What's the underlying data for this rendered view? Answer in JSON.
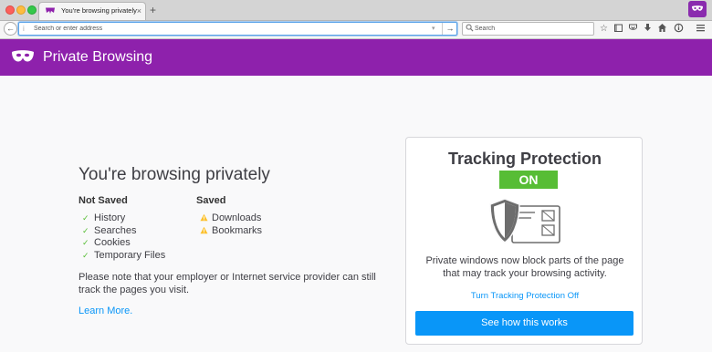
{
  "tab": {
    "title": "You're browsing privately",
    "close": "×",
    "new_tab": "+"
  },
  "navbar": {
    "back": "←",
    "url_placeholder": "Search or enter address",
    "url_info": "i",
    "url_dropdown": "▾",
    "url_go": "→",
    "search_placeholder": "Search",
    "toolbar_icons": [
      "star-icon",
      "reading-list-icon",
      "pocket-icon",
      "download-icon",
      "home-icon",
      "sync-icon",
      "menu-icon"
    ]
  },
  "header": {
    "title": "Private Browsing"
  },
  "main": {
    "title": "You're browsing privately",
    "not_saved": {
      "heading": "Not Saved",
      "items": [
        "History",
        "Searches",
        "Cookies",
        "Temporary Files"
      ]
    },
    "saved": {
      "heading": "Saved",
      "items": [
        "Downloads",
        "Bookmarks"
      ]
    },
    "note": "Please note that your employer or Internet service provider can still track the pages you visit.",
    "learn_more": "Learn More."
  },
  "card": {
    "title": "Tracking Protection",
    "status": "ON",
    "description": "Private windows now block parts of the page that may track your browsing activity.",
    "turn_off": "Turn Tracking Protection Off",
    "cta": "See how this works"
  },
  "colors": {
    "private_purple": "#8e21ac",
    "accent_blue": "#0996f8",
    "on_green": "#57bd35"
  }
}
